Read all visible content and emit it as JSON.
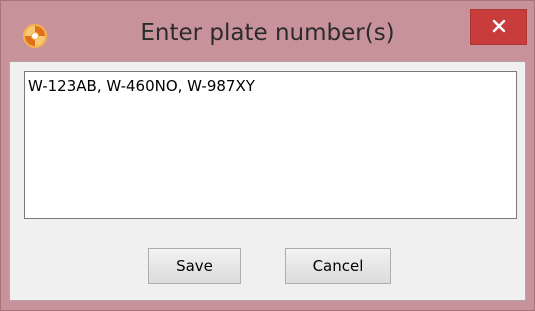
{
  "window": {
    "title": "Enter plate number(s)",
    "app_icon": "orange-swirl-icon",
    "close_icon": "close-icon"
  },
  "plates_field": {
    "value": "W-123AB, W-460NO, W-987XY"
  },
  "buttons": {
    "save_label": "Save",
    "cancel_label": "Cancel"
  },
  "colors": {
    "frame": "#c7929a",
    "close_button": "#c93c3c",
    "client_area": "#f0f0f0",
    "app_icon": "#f39a2b"
  }
}
